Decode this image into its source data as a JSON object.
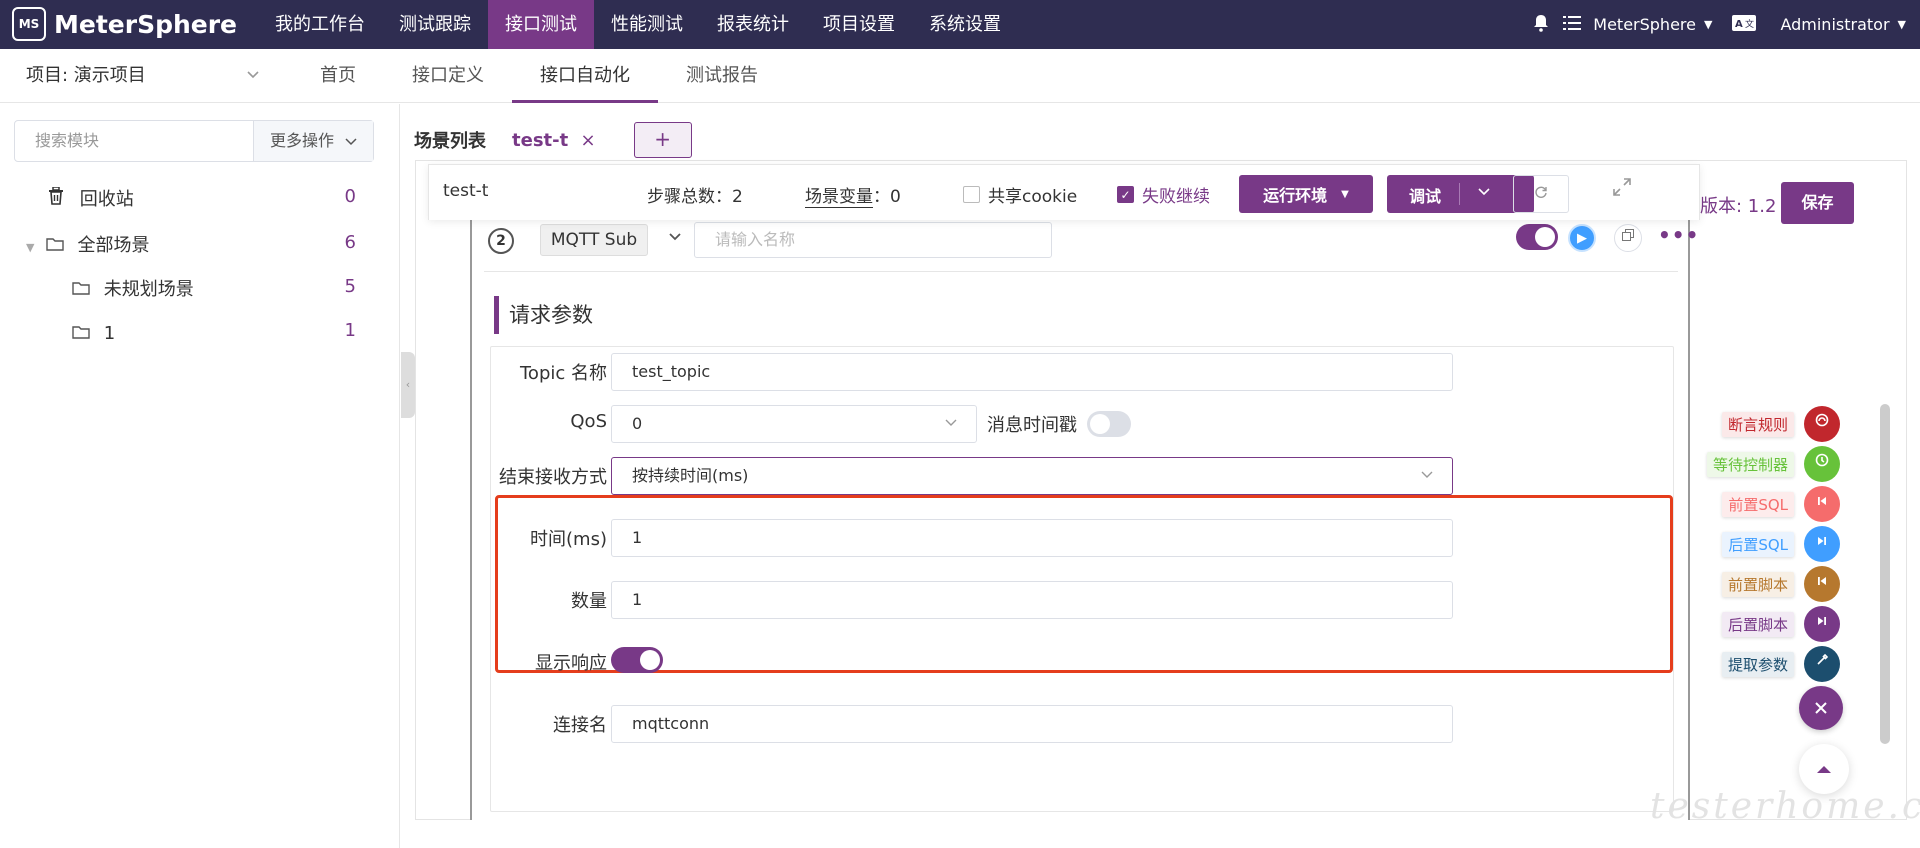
{
  "app": {
    "logo_badge": "MS",
    "logo_text": "MeterSphere"
  },
  "topnav": {
    "items": [
      "我的工作台",
      "测试跟踪",
      "接口测试",
      "性能测试",
      "报表统计",
      "项目设置",
      "系统设置"
    ],
    "active_index": 2,
    "workspace": "MeterSphere",
    "user": "Administrator",
    "dropdown_glyph": "▼"
  },
  "subnav": {
    "project_label": "项目: 演示项目",
    "tabs": [
      "首页",
      "接口定义",
      "接口自动化",
      "测试报告"
    ],
    "active_index": 2
  },
  "left": {
    "search_placeholder": "搜索模块",
    "more_actions": "更多操作",
    "tree": [
      {
        "label": "回收站",
        "count": "0",
        "icon": "trash-icon"
      },
      {
        "label": "全部场景",
        "count": "6",
        "icon": "folder-icon"
      },
      {
        "label": "未规划场景",
        "count": "5",
        "icon": "folder-icon"
      },
      {
        "label": "1",
        "count": "1",
        "icon": "folder-icon"
      }
    ]
  },
  "scenario_tabs": {
    "list_label": "场景列表",
    "open_tab": "test-t",
    "close_glyph": "×",
    "add_glyph": "+"
  },
  "scenario_header": {
    "name": "test-t",
    "steps_label": "步骤总数：",
    "steps_value": "2",
    "vars_label": "场景变量",
    "vars_sep": "：",
    "vars_value": "0",
    "share_cookie": "共享cookie",
    "fail_continue": "失败继续",
    "run_env": "运行环境",
    "debug": "调试",
    "version": "版本: 1.2",
    "save": "保存"
  },
  "step": {
    "number": "2",
    "type": "MQTT Sub",
    "name_placeholder": "请输入名称",
    "enabled": true,
    "more_glyph": "•••"
  },
  "request": {
    "section_title": "请求参数",
    "topic_label": "Topic 名称",
    "topic_value": "test_topic",
    "qos_label": "QoS",
    "qos_value": "0",
    "msg_timestamp_label": "消息时间戳",
    "msg_timestamp_on": false,
    "end_mode_label": "结束接收方式",
    "end_mode_value": "按持续时间(ms)",
    "time_label": "时间(ms)",
    "time_value": "1",
    "count_label": "数量",
    "count_value": "1",
    "show_response_label": "显示响应",
    "show_response_on": true,
    "conn_label": "连接名",
    "conn_value": "mqttconn"
  },
  "side_actions": [
    {
      "label": "断言规则",
      "color": "#c1272d",
      "bg": "#fbe9e9",
      "icon": "assert-icon"
    },
    {
      "label": "等待控制器",
      "color": "#67c23a",
      "bg": "#eef8e8",
      "icon": "clock-icon"
    },
    {
      "label": "前置SQL",
      "color": "#f56c6c",
      "bg": "#fdecec",
      "icon": "pre-sql-icon"
    },
    {
      "label": "后置SQL",
      "color": "#409eff",
      "bg": "#eaf3fe",
      "icon": "post-sql-icon"
    },
    {
      "label": "前置脚本",
      "color": "#b6782e",
      "bg": "#f7efe5",
      "icon": "pre-script-icon"
    },
    {
      "label": "后置脚本",
      "color": "#783987",
      "bg": "#f2eaf4",
      "icon": "post-script-icon"
    },
    {
      "label": "提取参数",
      "color": "#1c4e6e",
      "bg": "#e8eef2",
      "icon": "extract-icon"
    }
  ],
  "watermark": "testerhome.com",
  "colors": {
    "primary": "#783987",
    "topbar": "#2f2d51",
    "highlight": "#e53d1c"
  }
}
